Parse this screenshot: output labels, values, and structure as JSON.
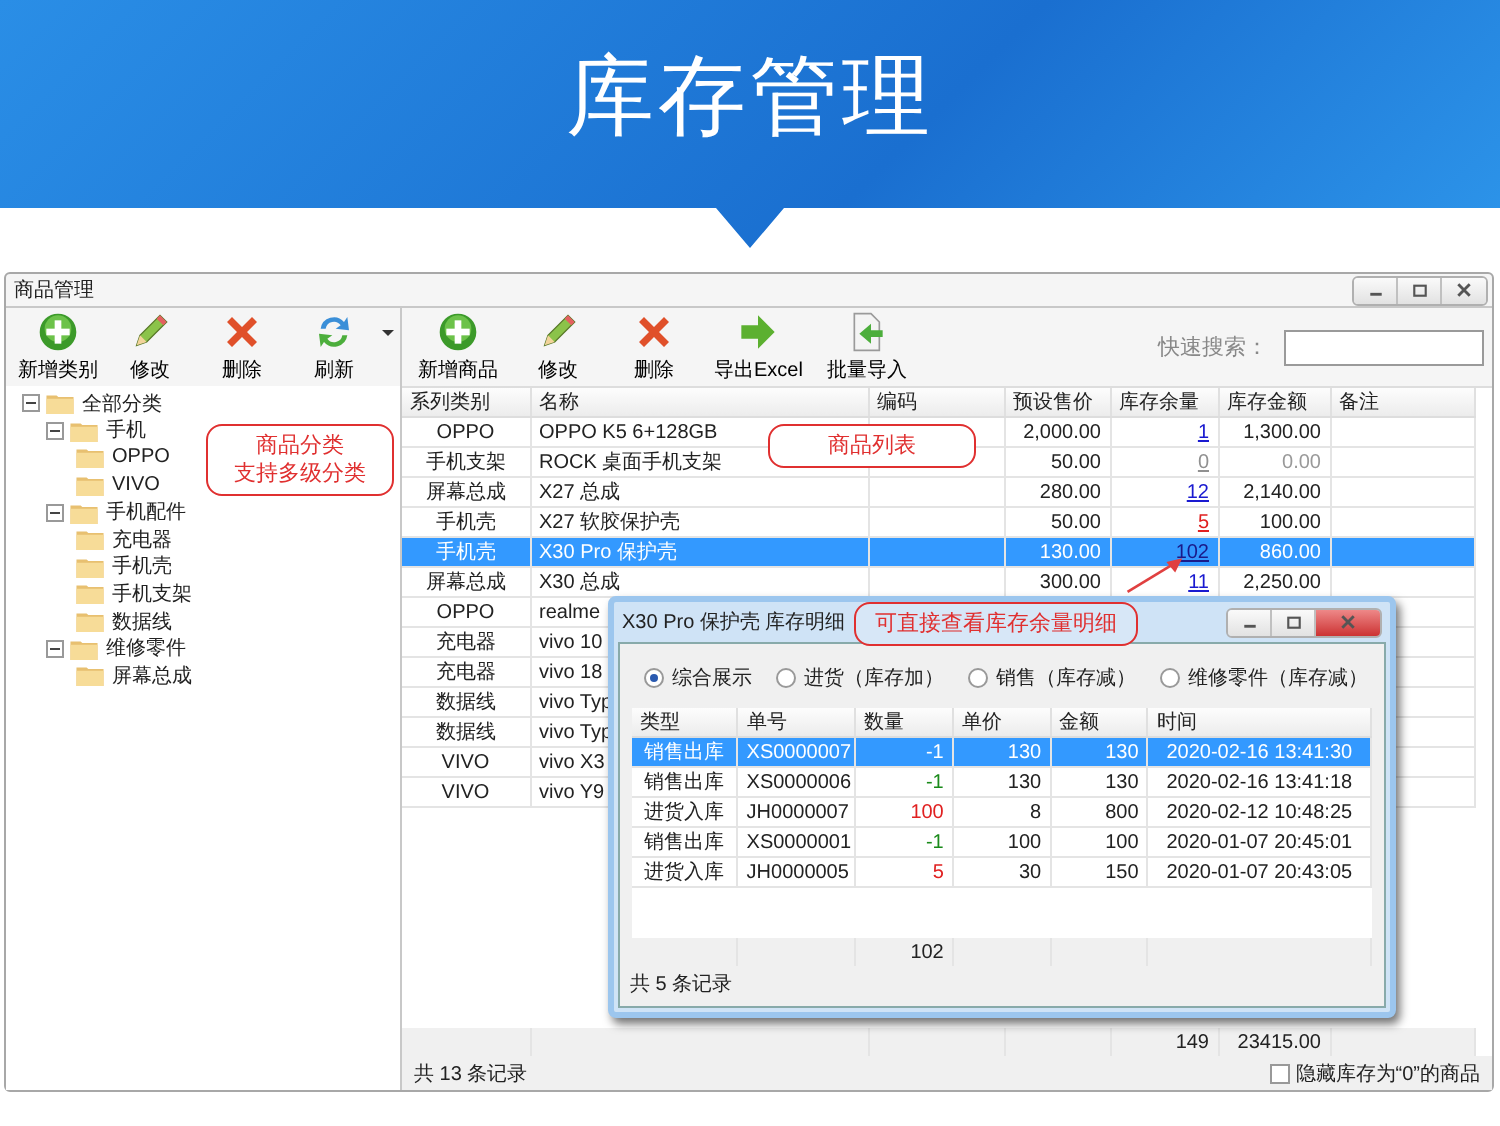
{
  "banner": {
    "title": "库存管理"
  },
  "window": {
    "title": "商品管理"
  },
  "category_toolbar": [
    {
      "kind": "add",
      "label": "新增类别",
      "has_dropdown": false
    },
    {
      "kind": "edit",
      "label": "修改",
      "has_dropdown": false
    },
    {
      "kind": "delete",
      "label": "删除",
      "has_dropdown": false
    },
    {
      "kind": "refresh",
      "label": "刷新",
      "has_dropdown": true
    }
  ],
  "category_tree": [
    {
      "label": "全部分类",
      "expanded": true,
      "children": [
        {
          "label": "手机",
          "expanded": true,
          "children": [
            {
              "label": "OPPO"
            },
            {
              "label": "VIVO"
            }
          ]
        },
        {
          "label": "手机配件",
          "expanded": true,
          "children": [
            {
              "label": "充电器"
            },
            {
              "label": "手机壳"
            },
            {
              "label": "手机支架"
            },
            {
              "label": "数据线"
            }
          ]
        },
        {
          "label": "维修零件",
          "expanded": true,
          "children": [
            {
              "label": "屏幕总成"
            }
          ]
        }
      ]
    }
  ],
  "annotations": [
    {
      "kind": "tree",
      "lines": [
        "商品分类",
        "支持多级分类"
      ]
    },
    {
      "kind": "list",
      "lines": [
        "商品列表"
      ]
    },
    {
      "kind": "dialog",
      "lines": [
        "可直接查看库存余量明细"
      ]
    }
  ],
  "product_toolbar": [
    {
      "kind": "add",
      "label": "新增商品"
    },
    {
      "kind": "edit",
      "label": "修改"
    },
    {
      "kind": "delete",
      "label": "删除"
    },
    {
      "kind": "export",
      "label": "导出Excel"
    },
    {
      "kind": "import",
      "label": "批量导入"
    }
  ],
  "search": {
    "label": "快速搜索："
  },
  "table": {
    "columns": [
      "系列类别",
      "名称",
      "编码",
      "预设售价",
      "库存余量",
      "库存金额",
      "备注"
    ],
    "rows": [
      {
        "category": "OPPO",
        "name": "OPPO K5 6+128GB",
        "price": "2,000.00",
        "stock": "1",
        "stock_low": false,
        "stock_empty": false,
        "amount": "1,300.00",
        "selected": false
      },
      {
        "category": "手机支架",
        "name": "ROCK 桌面手机支架",
        "price": "50.00",
        "stock": "0",
        "stock_low": false,
        "stock_empty": true,
        "amount": "0.00",
        "selected": false
      },
      {
        "category": "屏幕总成",
        "name": "X27 总成",
        "price": "280.00",
        "stock": "12",
        "stock_low": false,
        "stock_empty": false,
        "amount": "2,140.00",
        "selected": false
      },
      {
        "category": "手机壳",
        "name": "X27 软胶保护壳",
        "price": "50.00",
        "stock": "5",
        "stock_low": true,
        "stock_empty": false,
        "amount": "100.00",
        "selected": false
      },
      {
        "category": "手机壳",
        "name": "X30 Pro 保护壳",
        "price": "130.00",
        "stock": "102",
        "stock_low": false,
        "stock_empty": false,
        "amount": "860.00",
        "selected": true
      },
      {
        "category": "屏幕总成",
        "name": "X30 总成",
        "price": "300.00",
        "stock": "11",
        "stock_low": false,
        "stock_empty": false,
        "amount": "2,250.00",
        "selected": false
      },
      {
        "category": "OPPO",
        "name": "realme",
        "selected": false
      },
      {
        "category": "充电器",
        "name": "vivo 10",
        "selected": false
      },
      {
        "category": "充电器",
        "name": "vivo 18",
        "selected": false
      },
      {
        "category": "数据线",
        "name": "vivo Typ",
        "selected": false
      },
      {
        "category": "数据线",
        "name": "vivo Typ",
        "selected": false
      },
      {
        "category": "VIVO",
        "name": "vivo X3",
        "selected": false
      },
      {
        "category": "VIVO",
        "name": "vivo Y9",
        "selected": false
      }
    ],
    "totals": {
      "stock": "149",
      "amount": "23415.00"
    }
  },
  "status_bar": {
    "count": "共 13 条记录",
    "hide_zero": {
      "label": "隐藏库存为“0”的商品",
      "checked": false
    }
  },
  "dialog": {
    "title": "X30 Pro 保护壳 库存明细",
    "filters": [
      {
        "label": "综合展示",
        "selected": true
      },
      {
        "label": "进货（库存加）",
        "selected": false
      },
      {
        "label": "销售（库存减）",
        "selected": false
      },
      {
        "label": "维修零件（库存减）",
        "selected": false
      }
    ],
    "columns": [
      "类型",
      "单号",
      "数量",
      "单价",
      "金额",
      "时间"
    ],
    "rows": [
      {
        "type": "销售出库",
        "number": "XS0000007",
        "quantity": "-1",
        "incoming": false,
        "unit_price": "130",
        "amount": "130",
        "time": "2020-02-16 13:41:30",
        "selected": true
      },
      {
        "type": "销售出库",
        "number": "XS0000006",
        "quantity": "-1",
        "incoming": false,
        "unit_price": "130",
        "amount": "130",
        "time": "2020-02-16 13:41:18",
        "selected": false
      },
      {
        "type": "进货入库",
        "number": "JH0000007",
        "quantity": "100",
        "incoming": true,
        "unit_price": "8",
        "amount": "800",
        "time": "2020-02-12 10:48:25",
        "selected": false
      },
      {
        "type": "销售出库",
        "number": "XS0000001",
        "quantity": "-1",
        "incoming": false,
        "unit_price": "100",
        "amount": "100",
        "time": "2020-01-07 20:45:01",
        "selected": false
      },
      {
        "type": "进货入库",
        "number": "JH0000005",
        "quantity": "5",
        "incoming": true,
        "unit_price": "30",
        "amount": "150",
        "time": "2020-01-07 20:43:05",
        "selected": false
      }
    ],
    "total_quantity": "102",
    "count": "共 5 条记录"
  }
}
